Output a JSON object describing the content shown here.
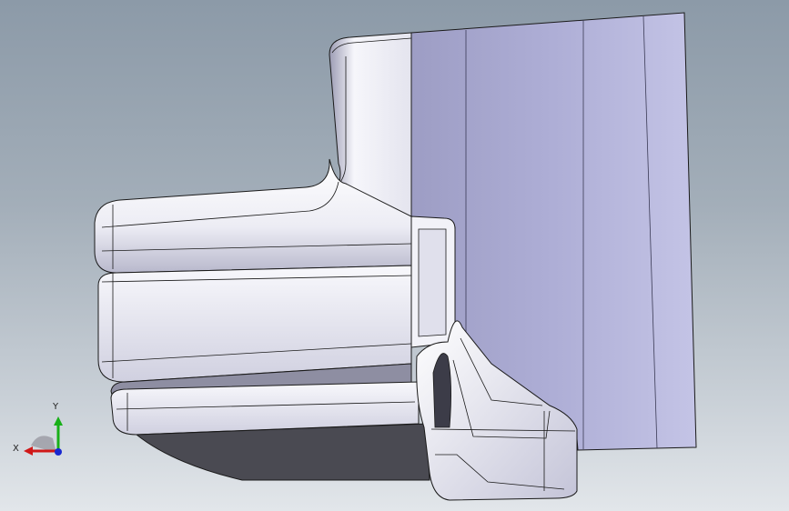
{
  "viewport": {
    "background_top": "#8c9aa8",
    "background_bottom": "#e2e6ea"
  },
  "model": {
    "face_light": "#f4f4fa",
    "face_mid": "#c8c8dc",
    "face_shadow": "#4a4a52",
    "plate_color": "#b0b0d4",
    "edge_color": "#1a1a1a"
  },
  "triad": {
    "x_label": "X",
    "y_label": "Y",
    "x_color": "#d01818",
    "y_color": "#18b018",
    "z_color": "#1828d0"
  }
}
